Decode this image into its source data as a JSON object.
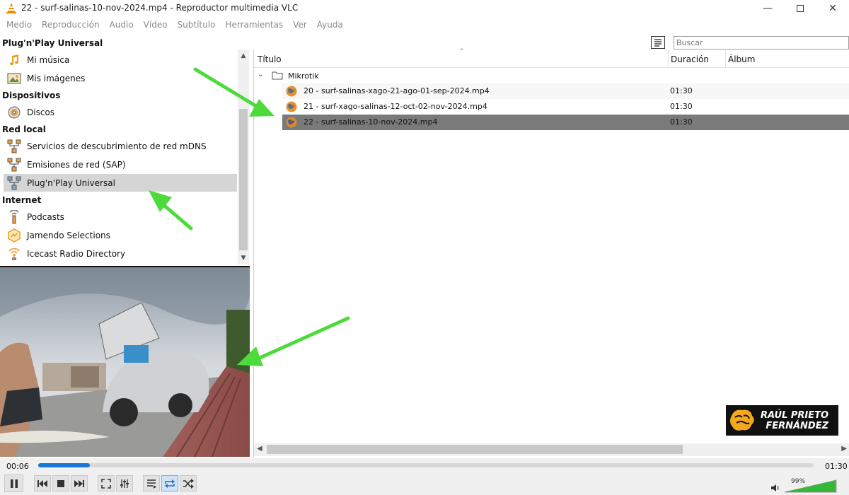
{
  "window": {
    "title": "22 - surf-salinas-10-nov-2024.mp4 - Reproductor multimedia VLC"
  },
  "menu": [
    "Medio",
    "Reproducción",
    "Audio",
    "Vídeo",
    "Subtítulo",
    "Herramientas",
    "Ver",
    "Ayuda"
  ],
  "sidebar": {
    "sections": [
      {
        "header": "Plug'n'Play Universal",
        "items": [
          {
            "label": "Mi música",
            "icon": "music-note-icon"
          },
          {
            "label": "Mis imágenes",
            "icon": "image-icon"
          }
        ]
      },
      {
        "header": "Dispositivos",
        "items": [
          {
            "label": "Discos",
            "icon": "disc-icon"
          }
        ]
      },
      {
        "header": "Red local",
        "items": [
          {
            "label": "Servicios de descubrimiento de red mDNS",
            "icon": "network-icon"
          },
          {
            "label": "Emisiones de red (SAP)",
            "icon": "network-icon"
          },
          {
            "label": "Plug'n'Play Universal",
            "icon": "network-icon",
            "selected": true
          }
        ]
      },
      {
        "header": "Internet",
        "items": [
          {
            "label": "Podcasts",
            "icon": "podcast-icon"
          },
          {
            "label": "Jamendo Selections",
            "icon": "jamendo-icon"
          },
          {
            "label": "Icecast Radio Directory",
            "icon": "radio-icon"
          }
        ]
      }
    ]
  },
  "playlist": {
    "search_placeholder": "Buscar",
    "columns": {
      "title": "Título",
      "duration": "Duración",
      "album": "Álbum"
    },
    "folder": "Mikrotik",
    "rows": [
      {
        "name": "20 - surf-salinas-xago-21-ago-01-sep-2024.mp4",
        "duration": "01:30"
      },
      {
        "name": "21 - surf-xago-salinas-12-oct-02-nov-2024.mp4",
        "duration": "01:30"
      },
      {
        "name": "22 - surf-salinas-10-nov-2024.mp4",
        "duration": "01:30",
        "selected": true
      }
    ]
  },
  "logo": {
    "line1": "RAÚL PRIETO",
    "line2": "FERNÁNDEZ"
  },
  "player": {
    "elapsed": "00:06",
    "total": "01:30",
    "progress": 0.067,
    "volume": "99%",
    "volume_level": 0.99
  },
  "colors": {
    "accent": "#1a78d4",
    "arrow": "#4cdb3a",
    "selected_row": "#7a7a7a",
    "vlc_orange": "#f08c00"
  }
}
